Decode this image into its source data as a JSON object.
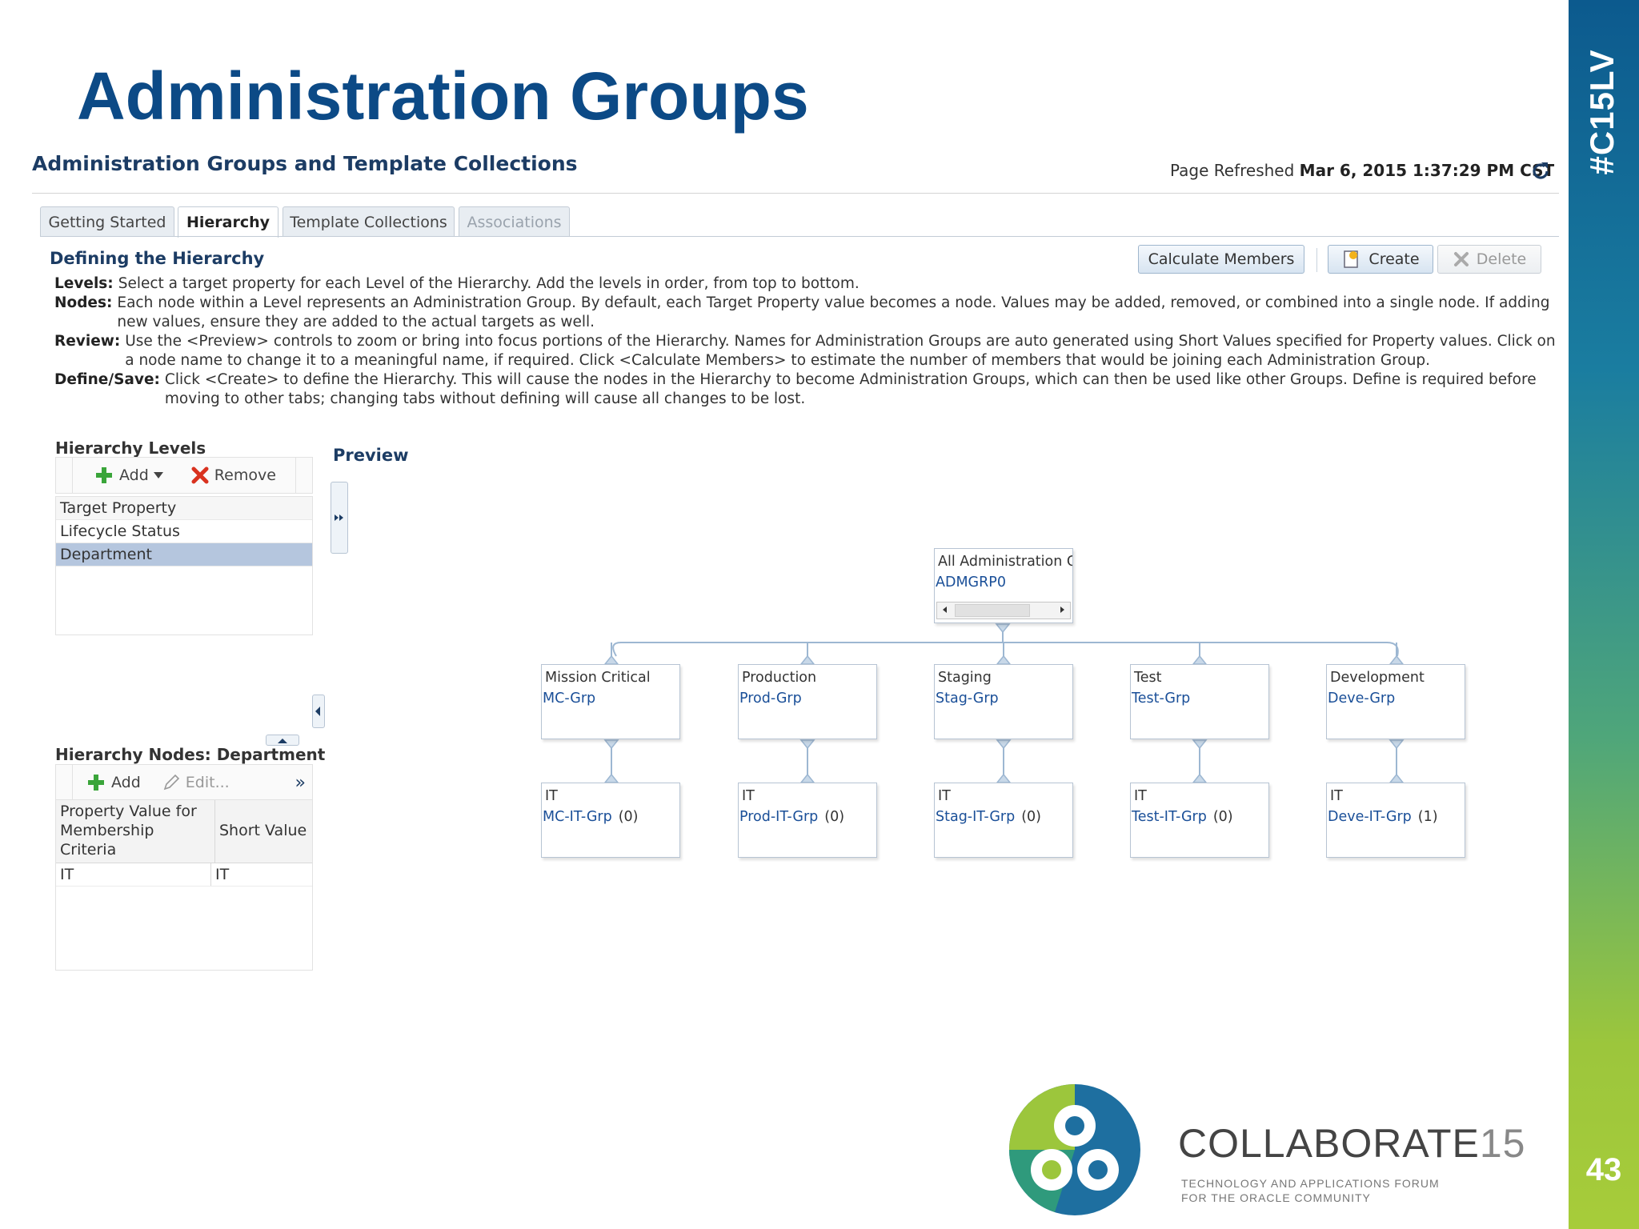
{
  "slide": {
    "title": "Administration Groups",
    "hashtag": "#C15LV",
    "page_number": "43",
    "brand": {
      "logo_main": "COLLABORATE",
      "logo_num": "15",
      "tagline_1": "TECHNOLOGY AND APPLICATIONS FORUM",
      "tagline_2": "FOR THE ORACLE COMMUNITY"
    }
  },
  "app": {
    "header_title": "Administration Groups and Template Collections",
    "refresh_label": "Page Refreshed",
    "refresh_time": "Mar 6, 2015 1:37:29 PM CST",
    "tabs": [
      {
        "label": "Getting Started",
        "state": "normal"
      },
      {
        "label": "Hierarchy",
        "state": "active"
      },
      {
        "label": "Template Collections",
        "state": "normal"
      },
      {
        "label": "Associations",
        "state": "disabled"
      }
    ],
    "section_title": "Defining the Hierarchy",
    "buttons": {
      "calculate": "Calculate Members",
      "create": "Create",
      "delete": "Delete"
    },
    "instructions": [
      {
        "term": "Levels:",
        "text": "Select a target property for each Level of the Hierarchy. Add the levels in order, from top to bottom."
      },
      {
        "term": "Nodes:",
        "text": "Each node within a Level represents an Administration Group. By default, each Target Property value becomes a node. Values may be added, removed, or combined into a single node. If adding new values, ensure they are added to the actual targets as well."
      },
      {
        "term": "Review:",
        "text": "Use the <Preview> controls to zoom or bring into focus portions of the Hierarchy. Names for Administration Groups are auto generated using Short Values specified for Property values. Click on a node name to change it to a meaningful name, if required. Click <Calculate Members> to estimate the number of members that would be joining each Administration Group."
      },
      {
        "term": "Define/Save:",
        "text": "Click <Create> to define the Hierarchy. This will cause the nodes in the Hierarchy to become Administration Groups, which can then be used like other Groups. Define is required before moving to other tabs; changing tabs without defining will cause all changes to be lost."
      }
    ],
    "levels": {
      "title": "Hierarchy Levels",
      "add_label": "Add",
      "remove_label": "Remove",
      "items": [
        "Target Property",
        "Lifecycle Status",
        "Department"
      ],
      "selected": "Department"
    },
    "nodes": {
      "title": "Hierarchy Nodes: Department",
      "add_label": "Add",
      "edit_label": "Edit...",
      "col1": "Property Value for Membership Criteria",
      "col2": "Short Value",
      "rows": [
        {
          "value": "IT",
          "short": "IT"
        }
      ]
    },
    "preview": {
      "title": "Preview",
      "root": {
        "title": "All Administration Gr",
        "link": "ADMGRP0"
      },
      "level1": [
        {
          "title": "Mission Critical",
          "link": "MC-Grp"
        },
        {
          "title": "Production",
          "link": "Prod-Grp"
        },
        {
          "title": "Staging",
          "link": "Stag-Grp"
        },
        {
          "title": "Test",
          "link": "Test-Grp"
        },
        {
          "title": "Development",
          "link": "Deve-Grp"
        }
      ],
      "level2": [
        {
          "title": "IT",
          "link": "MC-IT-Grp",
          "count": "(0)"
        },
        {
          "title": "IT",
          "link": "Prod-IT-Grp",
          "count": "(0)"
        },
        {
          "title": "IT",
          "link": "Stag-IT-Grp",
          "count": "(0)"
        },
        {
          "title": "IT",
          "link": "Test-IT-Grp",
          "count": "(0)"
        },
        {
          "title": "IT",
          "link": "Deve-IT-Grp",
          "count": "(1)"
        }
      ]
    }
  }
}
